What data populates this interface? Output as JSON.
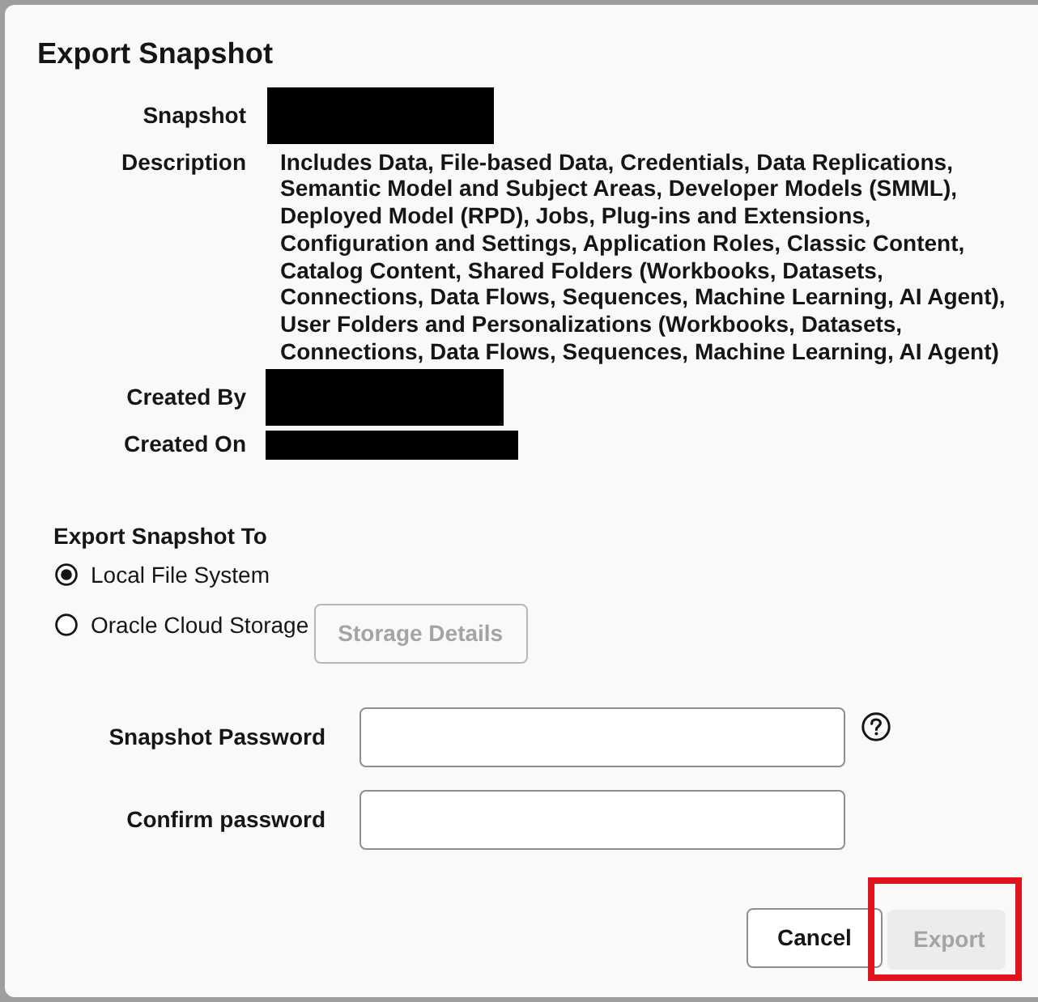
{
  "dialog": {
    "title": "Export Snapshot"
  },
  "details": [
    {
      "label": "Snapshot",
      "kind": "redacted"
    },
    {
      "label": "Description",
      "kind": "text",
      "value": "Includes Data, File-based Data, Credentials, Data Replications, Semantic Model and Subject Areas, Developer Models (SMML), Deployed Model (RPD), Jobs, Plug-ins and Extensions, Configuration and Settings, Application Roles, Classic Content, Catalog Content, Shared Folders (Workbooks, Datasets, Connections, Data Flows, Sequences, Machine Learning, AI Agent), User Folders and Personalizations (Workbooks, Datasets, Connections, Data Flows, Sequences, Machine Learning, AI Agent)"
    },
    {
      "label": "Created By",
      "kind": "redacted"
    },
    {
      "label": "Created On",
      "kind": "redacted"
    }
  ],
  "export_to": {
    "label": "Export Snapshot To",
    "options": [
      {
        "label": "Local File System",
        "selected": true
      },
      {
        "label": "Oracle Cloud Storage",
        "selected": false,
        "button": {
          "label": "Storage Details",
          "disabled": true
        }
      }
    ]
  },
  "password_fields": [
    {
      "label": "Snapshot Password",
      "help": true
    },
    {
      "label": "Confirm password",
      "help": false
    }
  ],
  "buttons": [
    {
      "label": "Cancel",
      "disabled": false,
      "highlighted": false
    },
    {
      "label": "Export",
      "disabled": true,
      "highlighted": true
    }
  ]
}
